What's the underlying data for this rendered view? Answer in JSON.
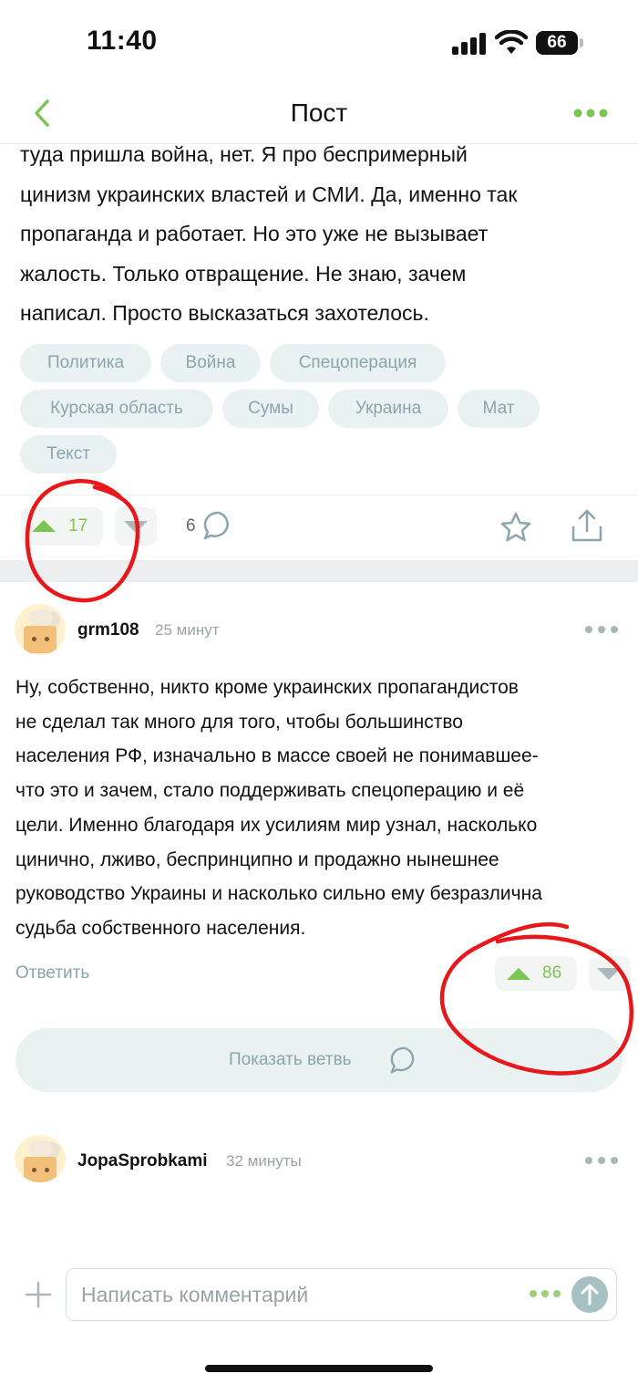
{
  "status_bar": {
    "time": "11:40",
    "battery": "66"
  },
  "nav": {
    "title": "Пост",
    "back_icon": "chevron-left-icon",
    "more_icon": "more-dots-icon"
  },
  "post": {
    "text_lines": [
      "туда пришла война, нет. Я про беспримерный",
      "цинизм украинских властей и СМИ. Да, именно так",
      "пропаганда и работает. Но это уже не вызывает",
      "жалость. Только отвращение. Не знаю, зачем",
      "написал. Просто высказаться захотелось."
    ],
    "tags": [
      "Политика",
      "Война",
      "Спецоперация",
      "Курская область",
      "Сумы",
      "Украина",
      "Мат",
      "Текст"
    ],
    "rating": "17",
    "comments_count": "6"
  },
  "comments": [
    {
      "username": "grm108",
      "time": "25 минут",
      "text_lines": [
        "Ну, собственно, никто кроме украинских пропагандистов",
        "не сделал так много для того, чтобы большинство",
        "населения РФ, изначально в массе своей не понимавшее-",
        "что это и зачем, стало поддерживать спецоперацию и её",
        "цели. Именно благодаря их усилиям мир узнал, насколько",
        "цинично, лживо, беспринципно и продажно нынешнее",
        "руководство Украины и насколько сильно ему безразлична",
        "судьба собственного населения."
      ],
      "reply_label": "Ответить",
      "rating": "86",
      "show_branch_label": "Показать ветвь"
    },
    {
      "username": "JopaSprobkami",
      "time": "32 минуты"
    }
  ],
  "composer": {
    "placeholder": "Написать комментарий"
  },
  "colors": {
    "accent_green": "#7dc552",
    "tag_bg": "#eaf1f2",
    "tag_text": "#8aa5ab",
    "annotation_red": "#e8171b"
  }
}
